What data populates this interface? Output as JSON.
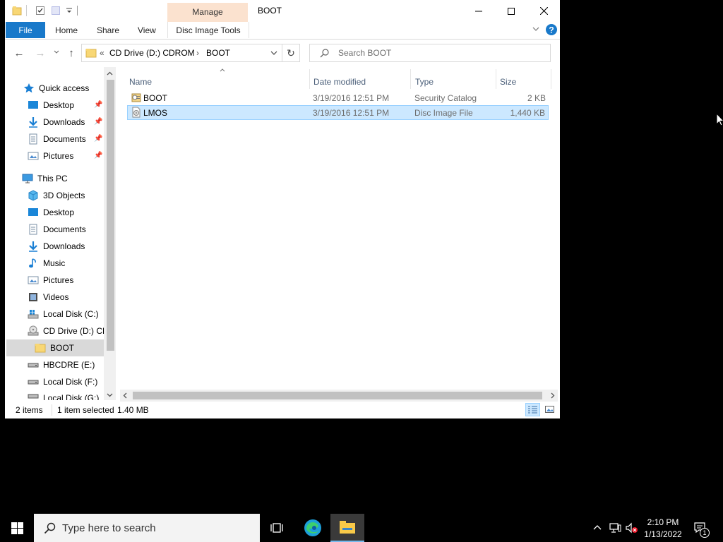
{
  "window": {
    "title": "BOOT",
    "context_tab": "Manage",
    "context_group": "Disc Image Tools",
    "ribbon_tabs": [
      "File",
      "Home",
      "Share",
      "View"
    ]
  },
  "address": {
    "overflow": "«",
    "crumbs": [
      "CD Drive (D:) CDROM",
      "BOOT"
    ],
    "separator": "›"
  },
  "search": {
    "placeholder": "Search BOOT"
  },
  "nav": {
    "quick_access": "Quick access",
    "quick_items": [
      "Desktop",
      "Downloads",
      "Documents",
      "Pictures"
    ],
    "this_pc": "This PC",
    "pc_items": [
      "3D Objects",
      "Desktop",
      "Documents",
      "Downloads",
      "Music",
      "Pictures",
      "Videos",
      "Local Disk (C:)",
      "CD Drive (D:) CDROM"
    ],
    "selected": "BOOT",
    "drives": [
      "HBCDRE (E:)",
      "Local Disk (F:)",
      "Local Disk (G:)"
    ]
  },
  "columns": {
    "name": "Name",
    "date": "Date modified",
    "type": "Type",
    "size": "Size"
  },
  "files": [
    {
      "name": "BOOT",
      "date": "3/19/2016 12:51 PM",
      "type": "Security Catalog",
      "size": "2 KB",
      "icon": "catalog-icon"
    },
    {
      "name": "LMOS",
      "date": "3/19/2016 12:51 PM",
      "type": "Disc Image File",
      "size": "1,440 KB",
      "icon": "disc-image-icon"
    }
  ],
  "status": {
    "items": "2 items",
    "selected": "1 item selected",
    "size": "1.40 MB"
  },
  "taskbar": {
    "search_placeholder": "Type here to search",
    "time": "2:10 PM",
    "date": "1/13/2022",
    "notif_count": "1"
  },
  "colors": {
    "accent": "#1979ca",
    "selection": "#cce8ff",
    "context_tab": "#fbe2cf",
    "help": "#1979ca"
  }
}
